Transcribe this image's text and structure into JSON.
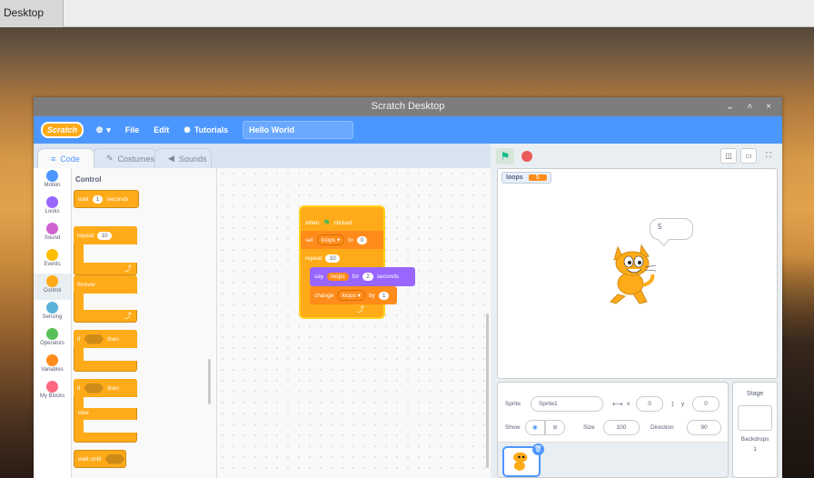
{
  "desktop": {
    "tab_label": "Desktop"
  },
  "window": {
    "title": "Scratch Desktop",
    "controls": "⌄ ˄ ×"
  },
  "menubar": {
    "logo": "Scratch",
    "language_icon": "globe-icon",
    "file": "File",
    "edit": "Edit",
    "tutorials": "Tutorials",
    "project_name": "Hello World"
  },
  "tabs": {
    "code": "Code",
    "costumes": "Costumes",
    "sounds": "Sounds"
  },
  "categories": [
    {
      "label": "Motion",
      "color": "#4c97ff"
    },
    {
      "label": "Looks",
      "color": "#9966ff"
    },
    {
      "label": "Sound",
      "color": "#cf63cf"
    },
    {
      "label": "Events",
      "color": "#ffbf00"
    },
    {
      "label": "Control",
      "color": "#ffab19"
    },
    {
      "label": "Sensing",
      "color": "#5cb1d6"
    },
    {
      "label": "Operators",
      "color": "#59c059"
    },
    {
      "label": "Variables",
      "color": "#ff8c1a"
    },
    {
      "label": "My Blocks",
      "color": "#ff6680"
    }
  ],
  "palette": {
    "title": "Control",
    "wait_label": "wait",
    "wait_value": "1",
    "wait_unit": "seconds",
    "repeat_label": "repeat",
    "repeat_value": "10",
    "forever_label": "forever",
    "if_label": "if",
    "then_label": "then",
    "if2_label": "if",
    "then2_label": "then",
    "else_label": "else",
    "wait_until_label": "wait until"
  },
  "script": {
    "hat_when": "when",
    "hat_clicked": "clicked",
    "set_label": "set",
    "set_var": "loops ▾",
    "set_to": "to",
    "set_value": "0",
    "repeat_label": "repeat",
    "repeat_value": "10",
    "say_label": "say",
    "say_var": "loops",
    "say_for": "for",
    "say_secs": "2",
    "say_unit": "seconds",
    "change_label": "change",
    "change_var": "loops ▾",
    "change_by": "by",
    "change_value": "1"
  },
  "stage": {
    "monitor_name": "loops",
    "monitor_value": "5",
    "speech": "5"
  },
  "sprite_info": {
    "sprite_label": "Sprite",
    "sprite_name": "Sprite1",
    "x_label": "x",
    "x_value": "0",
    "y_label": "y",
    "y_value": "0",
    "show_label": "Show",
    "size_label": "Size",
    "size_value": "100",
    "direction_label": "Direction",
    "direction_value": "90"
  },
  "stage_pane": {
    "title": "Stage",
    "backdrops_label": "Backdrops",
    "backdrops_count": "1"
  }
}
